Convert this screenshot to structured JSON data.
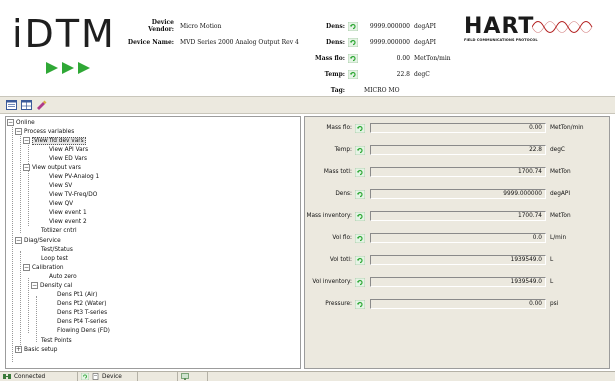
{
  "logo": {
    "text": "iDTM"
  },
  "device": {
    "vendor_label": "Device Vendor:",
    "vendor_value": "Micro Motion",
    "name_label": "Device Name:",
    "name_value": "MVD Series 2000 Analog Output Rev 4"
  },
  "summary": [
    {
      "label": "Dens:",
      "value": "9999.000000",
      "unit": "degAPI"
    },
    {
      "label": "Dens:",
      "value": "9999.000000",
      "unit": "degAPI"
    },
    {
      "label": "Mass flo:",
      "value": "0.00",
      "unit": "MetTon/min"
    },
    {
      "label": "Temp:",
      "value": "22.8",
      "unit": "degC"
    }
  ],
  "tag": {
    "label": "Tag:",
    "value": "MICRO MO"
  },
  "hart": {
    "title": "HART",
    "subtitle": "FIELD COMMUNICATIONS PROTOCOL"
  },
  "tree": {
    "items": [
      {
        "label": "Online"
      },
      {
        "label": "Process variables"
      },
      {
        "label": "View fld dev vars"
      },
      {
        "label": "View API Vars"
      },
      {
        "label": "View ED Vars"
      },
      {
        "label": "View output vars"
      },
      {
        "label": "View PV-Analog 1"
      },
      {
        "label": "View SV"
      },
      {
        "label": "View TV-Freq/DO"
      },
      {
        "label": "View QV"
      },
      {
        "label": "View event 1"
      },
      {
        "label": "View event 2"
      },
      {
        "label": "Totlizer cntrl"
      },
      {
        "label": "Diag/Service"
      },
      {
        "label": "Test/Status"
      },
      {
        "label": "Loop test"
      },
      {
        "label": "Calibration"
      },
      {
        "label": "Auto zero"
      },
      {
        "label": "Density cal"
      },
      {
        "label": "Dens Pt1 (Air)"
      },
      {
        "label": "Dens Pt2 (Water)"
      },
      {
        "label": "Dens Pt3 T-series"
      },
      {
        "label": "Dens Pt4 T-series"
      },
      {
        "label": "Flowing Dens (FD)"
      },
      {
        "label": "Test Points"
      },
      {
        "label": "Basic setup"
      }
    ]
  },
  "variables": [
    {
      "label": "Mass flo:",
      "value": "0.00",
      "unit": "MetTon/min"
    },
    {
      "label": "Temp:",
      "value": "22.8",
      "unit": "degC"
    },
    {
      "label": "Mass totl:",
      "value": "1700.74",
      "unit": "MetTon"
    },
    {
      "label": "Dens:",
      "value": "9999.000000",
      "unit": "degAPI"
    },
    {
      "label": "Mass inventory:",
      "value": "1700.74",
      "unit": "MetTon"
    },
    {
      "label": "Vol flo:",
      "value": "0.0",
      "unit": "L/min"
    },
    {
      "label": "Vol totl:",
      "value": "1939549.0",
      "unit": "L"
    },
    {
      "label": "Vol inventory:",
      "value": "1939549.0",
      "unit": "L"
    },
    {
      "label": "Pressure:",
      "value": "0.00",
      "unit": "psi"
    }
  ],
  "status": {
    "connection": "Connected",
    "device": "Device"
  },
  "colors": {
    "accent_green": "#2fa836",
    "panel_bg": "#ece9df"
  }
}
